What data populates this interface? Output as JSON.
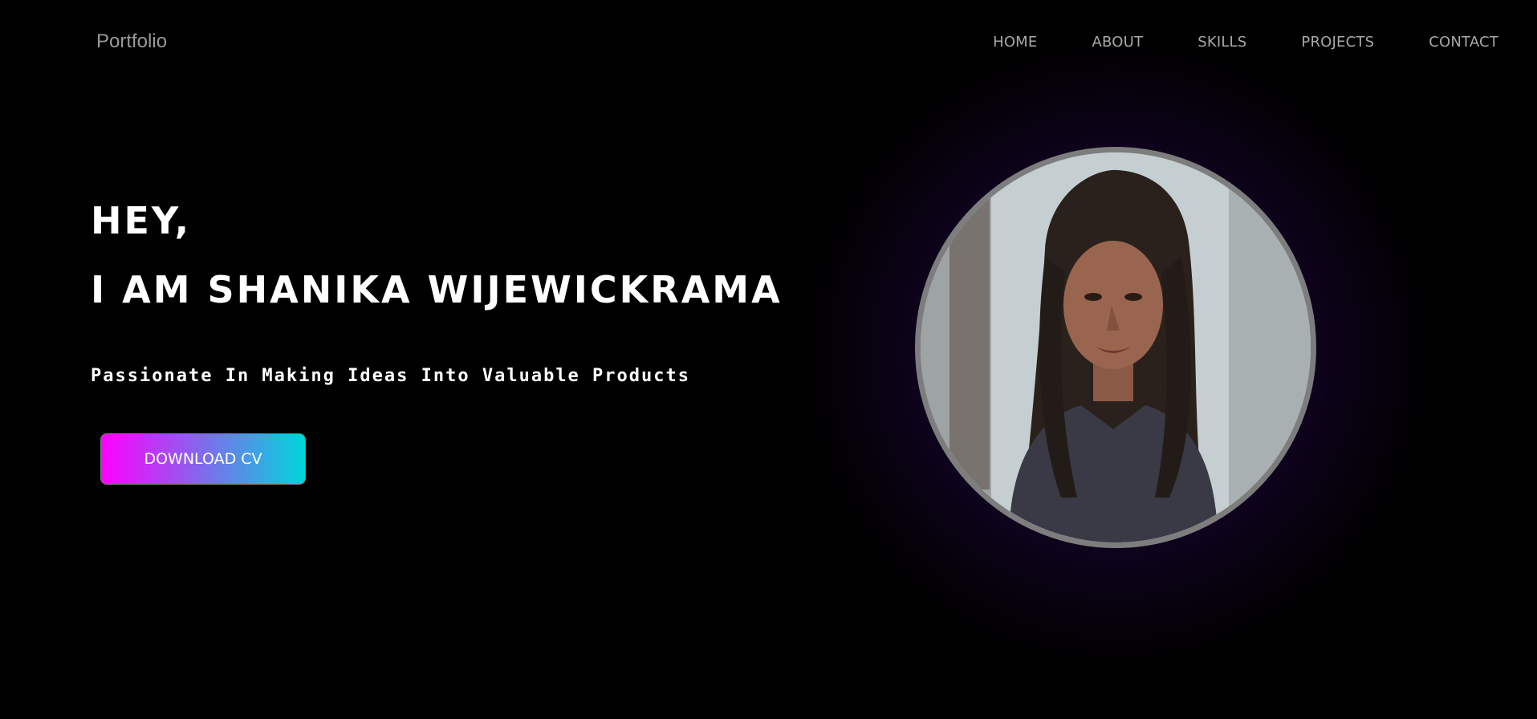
{
  "header": {
    "brand": "Portfolio",
    "nav": [
      "HOME",
      "ABOUT",
      "SKILLS",
      "PROJECTS",
      "CONTACT"
    ]
  },
  "hero": {
    "greeting": "HEY,",
    "name": "I AM SHANIKA WIJEWICKRAMA",
    "tagline": "Passionate In Making Ideas Into Valuable Products",
    "download_label": "DOWNLOAD CV"
  },
  "colors": {
    "background": "#000000",
    "nav_text": "#a8a8a8",
    "button_gradient_start": "#ff00ff",
    "button_gradient_end": "#00d6db",
    "glow": "#32105f",
    "portrait_ring": "#7d7d7d"
  }
}
